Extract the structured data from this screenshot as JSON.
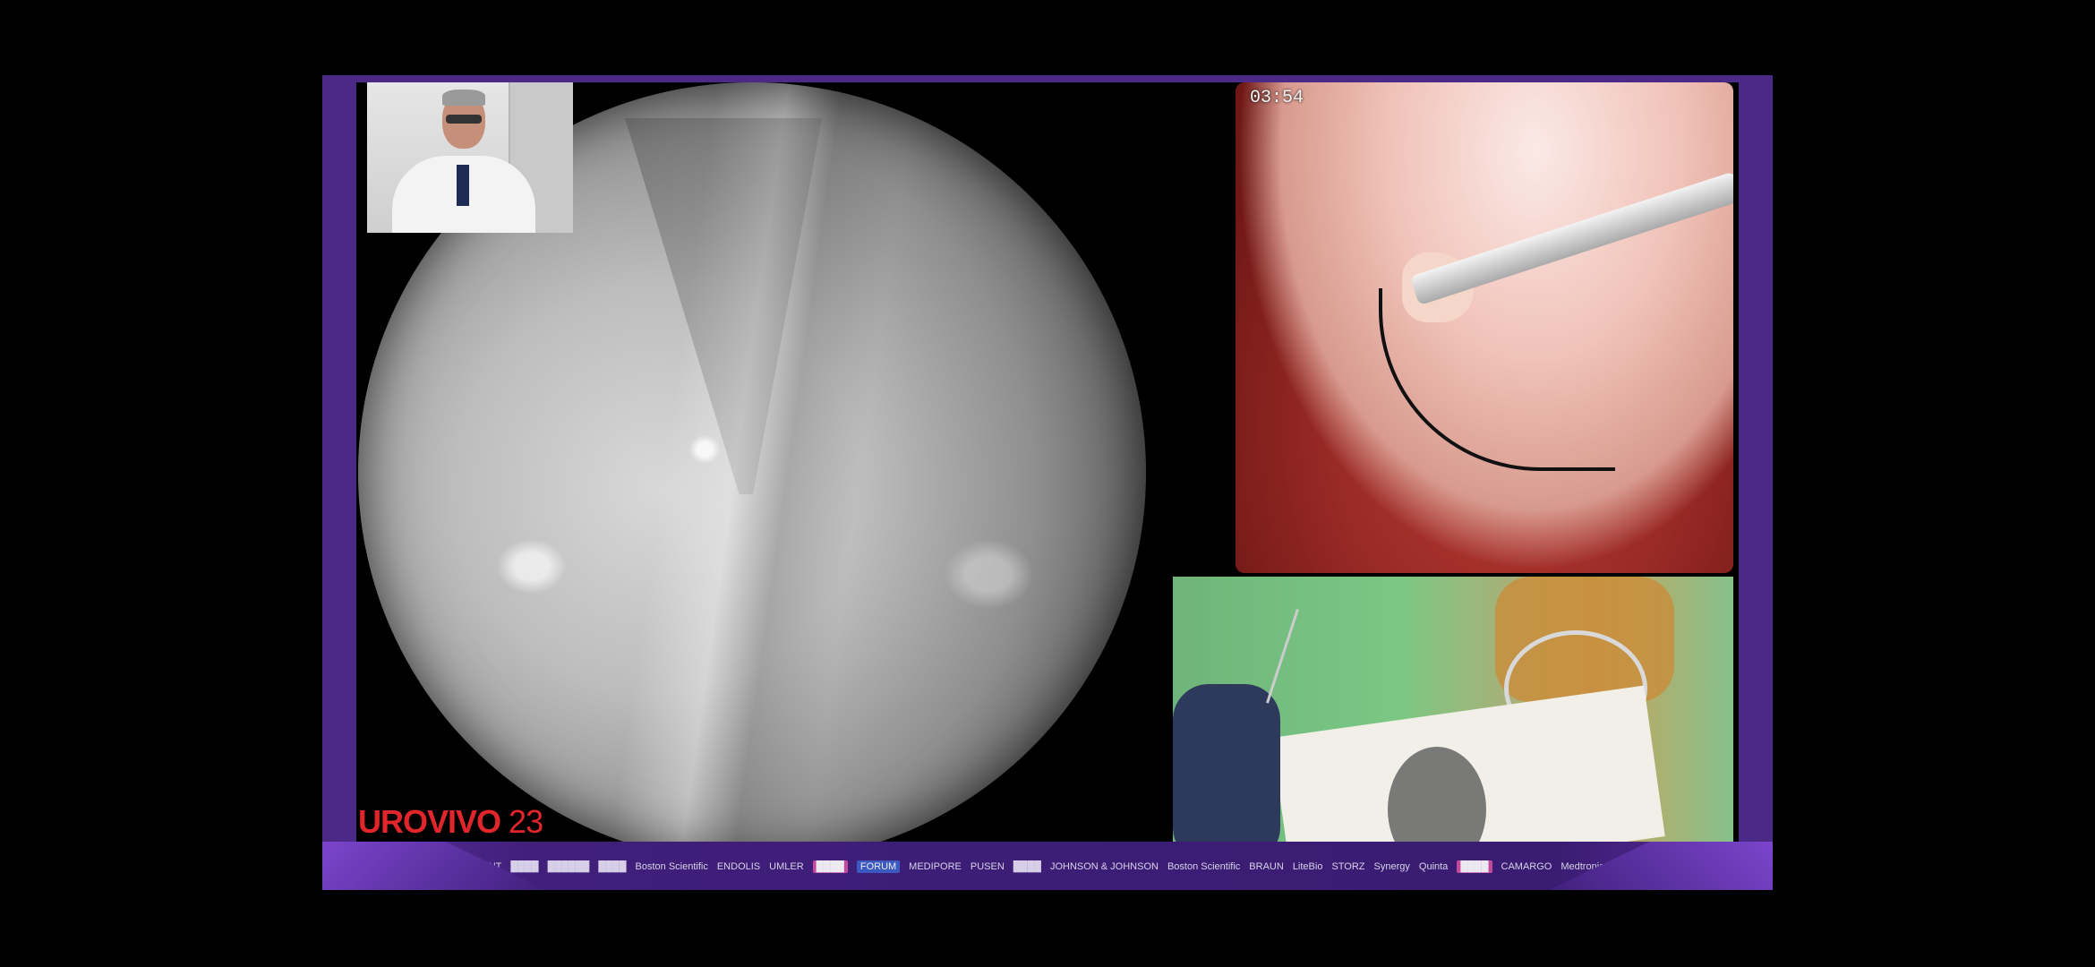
{
  "stream": {
    "timestamp": "03:54",
    "logo": {
      "name": "UROVIVO",
      "year": "23"
    }
  },
  "sponsors": [
    "PROSENT",
    "████",
    "██████",
    "████",
    "Boston Scientific",
    "ENDOLIS",
    "UMLER",
    "████",
    "FORUM",
    "MEDIPORE",
    "PUSEN",
    "████",
    "JOHNSON & JOHNSON",
    "Boston Scientific",
    "BRAUN",
    "LiteBio",
    "STORZ",
    "Synergy",
    "Quinta",
    "████",
    "CAMARGO",
    "Medtronic",
    "████"
  ],
  "colors": {
    "frame": "#4a2a86",
    "logo": "#e0262b"
  },
  "icons": {
    "presenter": "presenter-icon"
  }
}
